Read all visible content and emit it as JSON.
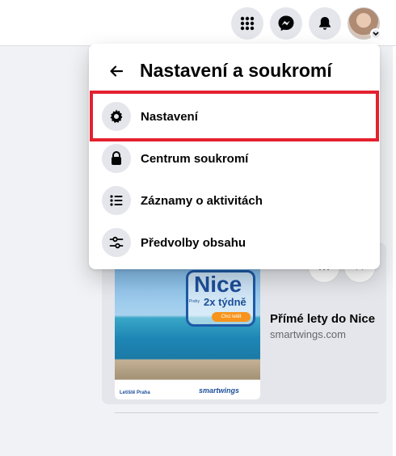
{
  "menu": {
    "title": "Nastavení a soukromí",
    "items": [
      {
        "label": "Nastavení",
        "icon": "gear-icon"
      },
      {
        "label": "Centrum soukromí",
        "icon": "lock-icon"
      },
      {
        "label": "Záznamy o aktivitách",
        "icon": "list-icon"
      },
      {
        "label": "Předvolby obsahu",
        "icon": "sliders-icon"
      }
    ]
  },
  "ad": {
    "title": "Přímé lety do Nice",
    "domain": "smartwings.com",
    "image_text": {
      "headline": "Nice",
      "from": "z Prahy",
      "frequency": "2x týdně",
      "cta": "Chci letět",
      "logo_left": "Letiště Praha",
      "logo_right": "smartwings"
    }
  },
  "colors": {
    "highlight": "#e4202f",
    "icon_bg": "#e4e6eb",
    "messenger": "#050505"
  }
}
